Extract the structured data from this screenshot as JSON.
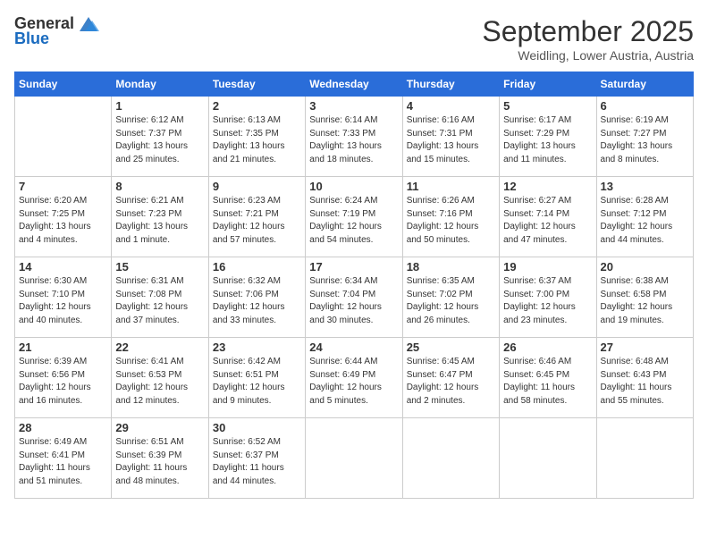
{
  "header": {
    "logo_general": "General",
    "logo_blue": "Blue",
    "month": "September 2025",
    "location": "Weidling, Lower Austria, Austria"
  },
  "weekdays": [
    "Sunday",
    "Monday",
    "Tuesday",
    "Wednesday",
    "Thursday",
    "Friday",
    "Saturday"
  ],
  "weeks": [
    [
      {
        "day": "",
        "info": ""
      },
      {
        "day": "1",
        "info": "Sunrise: 6:12 AM\nSunset: 7:37 PM\nDaylight: 13 hours\nand 25 minutes."
      },
      {
        "day": "2",
        "info": "Sunrise: 6:13 AM\nSunset: 7:35 PM\nDaylight: 13 hours\nand 21 minutes."
      },
      {
        "day": "3",
        "info": "Sunrise: 6:14 AM\nSunset: 7:33 PM\nDaylight: 13 hours\nand 18 minutes."
      },
      {
        "day": "4",
        "info": "Sunrise: 6:16 AM\nSunset: 7:31 PM\nDaylight: 13 hours\nand 15 minutes."
      },
      {
        "day": "5",
        "info": "Sunrise: 6:17 AM\nSunset: 7:29 PM\nDaylight: 13 hours\nand 11 minutes."
      },
      {
        "day": "6",
        "info": "Sunrise: 6:19 AM\nSunset: 7:27 PM\nDaylight: 13 hours\nand 8 minutes."
      }
    ],
    [
      {
        "day": "7",
        "info": "Sunrise: 6:20 AM\nSunset: 7:25 PM\nDaylight: 13 hours\nand 4 minutes."
      },
      {
        "day": "8",
        "info": "Sunrise: 6:21 AM\nSunset: 7:23 PM\nDaylight: 13 hours\nand 1 minute."
      },
      {
        "day": "9",
        "info": "Sunrise: 6:23 AM\nSunset: 7:21 PM\nDaylight: 12 hours\nand 57 minutes."
      },
      {
        "day": "10",
        "info": "Sunrise: 6:24 AM\nSunset: 7:19 PM\nDaylight: 12 hours\nand 54 minutes."
      },
      {
        "day": "11",
        "info": "Sunrise: 6:26 AM\nSunset: 7:16 PM\nDaylight: 12 hours\nand 50 minutes."
      },
      {
        "day": "12",
        "info": "Sunrise: 6:27 AM\nSunset: 7:14 PM\nDaylight: 12 hours\nand 47 minutes."
      },
      {
        "day": "13",
        "info": "Sunrise: 6:28 AM\nSunset: 7:12 PM\nDaylight: 12 hours\nand 44 minutes."
      }
    ],
    [
      {
        "day": "14",
        "info": "Sunrise: 6:30 AM\nSunset: 7:10 PM\nDaylight: 12 hours\nand 40 minutes."
      },
      {
        "day": "15",
        "info": "Sunrise: 6:31 AM\nSunset: 7:08 PM\nDaylight: 12 hours\nand 37 minutes."
      },
      {
        "day": "16",
        "info": "Sunrise: 6:32 AM\nSunset: 7:06 PM\nDaylight: 12 hours\nand 33 minutes."
      },
      {
        "day": "17",
        "info": "Sunrise: 6:34 AM\nSunset: 7:04 PM\nDaylight: 12 hours\nand 30 minutes."
      },
      {
        "day": "18",
        "info": "Sunrise: 6:35 AM\nSunset: 7:02 PM\nDaylight: 12 hours\nand 26 minutes."
      },
      {
        "day": "19",
        "info": "Sunrise: 6:37 AM\nSunset: 7:00 PM\nDaylight: 12 hours\nand 23 minutes."
      },
      {
        "day": "20",
        "info": "Sunrise: 6:38 AM\nSunset: 6:58 PM\nDaylight: 12 hours\nand 19 minutes."
      }
    ],
    [
      {
        "day": "21",
        "info": "Sunrise: 6:39 AM\nSunset: 6:56 PM\nDaylight: 12 hours\nand 16 minutes."
      },
      {
        "day": "22",
        "info": "Sunrise: 6:41 AM\nSunset: 6:53 PM\nDaylight: 12 hours\nand 12 minutes."
      },
      {
        "day": "23",
        "info": "Sunrise: 6:42 AM\nSunset: 6:51 PM\nDaylight: 12 hours\nand 9 minutes."
      },
      {
        "day": "24",
        "info": "Sunrise: 6:44 AM\nSunset: 6:49 PM\nDaylight: 12 hours\nand 5 minutes."
      },
      {
        "day": "25",
        "info": "Sunrise: 6:45 AM\nSunset: 6:47 PM\nDaylight: 12 hours\nand 2 minutes."
      },
      {
        "day": "26",
        "info": "Sunrise: 6:46 AM\nSunset: 6:45 PM\nDaylight: 11 hours\nand 58 minutes."
      },
      {
        "day": "27",
        "info": "Sunrise: 6:48 AM\nSunset: 6:43 PM\nDaylight: 11 hours\nand 55 minutes."
      }
    ],
    [
      {
        "day": "28",
        "info": "Sunrise: 6:49 AM\nSunset: 6:41 PM\nDaylight: 11 hours\nand 51 minutes."
      },
      {
        "day": "29",
        "info": "Sunrise: 6:51 AM\nSunset: 6:39 PM\nDaylight: 11 hours\nand 48 minutes."
      },
      {
        "day": "30",
        "info": "Sunrise: 6:52 AM\nSunset: 6:37 PM\nDaylight: 11 hours\nand 44 minutes."
      },
      {
        "day": "",
        "info": ""
      },
      {
        "day": "",
        "info": ""
      },
      {
        "day": "",
        "info": ""
      },
      {
        "day": "",
        "info": ""
      }
    ]
  ]
}
